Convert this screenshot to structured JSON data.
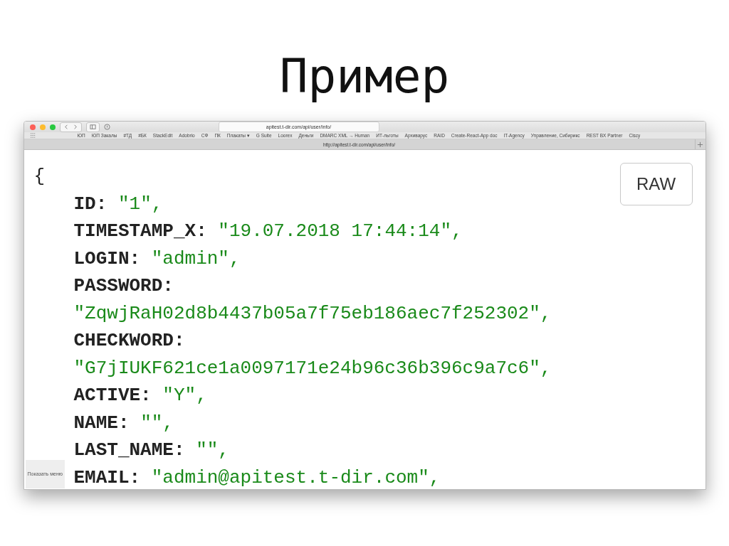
{
  "slide_title": "Пример",
  "browser": {
    "address": "apitest.t-dir.com/api/user/info/",
    "bookmarks": [
      "ЮП",
      "ЮП Закалы",
      "#ТД",
      "#БК",
      "StackEdit",
      "Adobrio",
      "СФ",
      "ПК",
      "Плакаты ▾",
      "G Suite",
      "Loorex",
      "Деньги",
      "DMARC XML → Human",
      "ИТ-льготы",
      "Архиварус",
      "RAID",
      "Create-React-App doc",
      "IT-Agency",
      "Управление, Сибирикс",
      "REST BX Partner",
      "Ciscy"
    ],
    "tab_url": "http://apitest.t-dir.com/api/user/info/",
    "status_hint": "Показать меню"
  },
  "json_view": {
    "open_brace": "{",
    "raw_button": "RAW",
    "fields": [
      {
        "key": "ID:",
        "value": "\"1\",",
        "kind": "inline"
      },
      {
        "key": "TIMESTAMP_X:",
        "value": "\"19.07.2018 17:44:14\",",
        "kind": "inline"
      },
      {
        "key": "LOGIN:",
        "value": "\"admin\",",
        "kind": "inline"
      },
      {
        "key": "PASSWORD:",
        "value": "\"ZqwjRaH02d8b4437b05a7f75eb186aec7f252302\",",
        "kind": "wrapped"
      },
      {
        "key": "CHECKWORD:",
        "value": "\"G7jIUKF621ce1a0097171e24b96c36b396c9a7c6\",",
        "kind": "wrapped"
      },
      {
        "key": "ACTIVE:",
        "value": "\"Y\",",
        "kind": "inline"
      },
      {
        "key": "NAME:",
        "value": "\"\",",
        "kind": "inline"
      },
      {
        "key": "LAST_NAME:",
        "value": "\"\",",
        "kind": "inline"
      },
      {
        "key": "EMAIL:",
        "value": "\"admin@apitest.t-dir.com\",",
        "kind": "inline"
      }
    ]
  }
}
